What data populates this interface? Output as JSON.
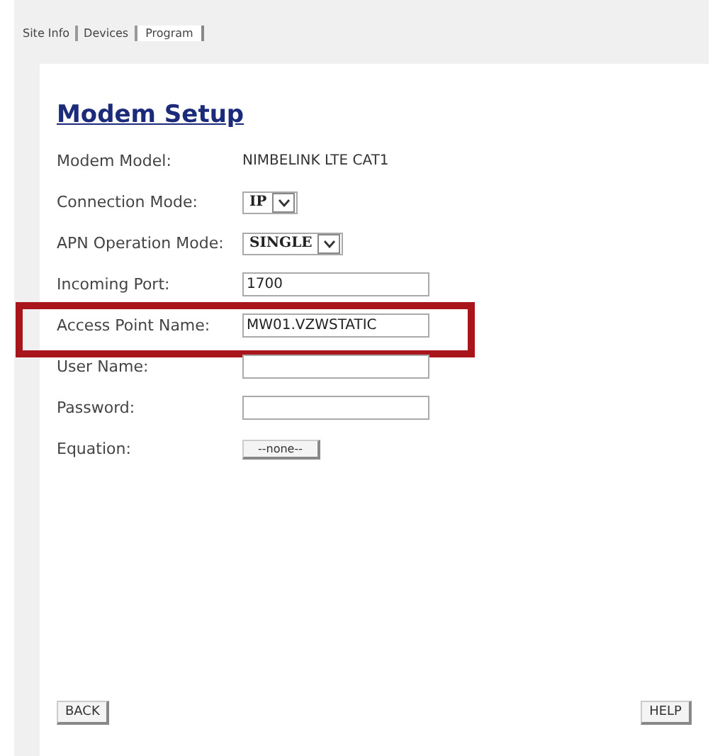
{
  "tabs": [
    {
      "label": "Site Info",
      "selected": false
    },
    {
      "label": "Devices",
      "selected": false
    },
    {
      "label": "Program",
      "selected": true
    }
  ],
  "title": "Modem Setup",
  "rows": [
    {
      "label": "Modem Model:",
      "kind": "text",
      "value": "NIMBELINK LTE CAT1",
      "highlighted": false
    },
    {
      "label": "Connection Mode:",
      "kind": "select",
      "value": "IP",
      "highlighted": false
    },
    {
      "label": "APN Operation Mode:",
      "kind": "select",
      "value": "SINGLE",
      "highlighted": false
    },
    {
      "label": "Incoming Port:",
      "kind": "input",
      "value": "1700",
      "highlighted": false
    },
    {
      "label": "Access Point Name:",
      "kind": "input",
      "value": "MW01.VZWSTATIC",
      "highlighted": true
    },
    {
      "label": "User Name:",
      "kind": "input",
      "highlighted": false
    },
    {
      "label": "Password:",
      "kind": "input",
      "highlighted": false
    },
    {
      "label": "Equation:",
      "kind": "button",
      "value": "--none--",
      "highlighted": false
    }
  ],
  "buttons": [
    "BACK",
    "HELP"
  ]
}
